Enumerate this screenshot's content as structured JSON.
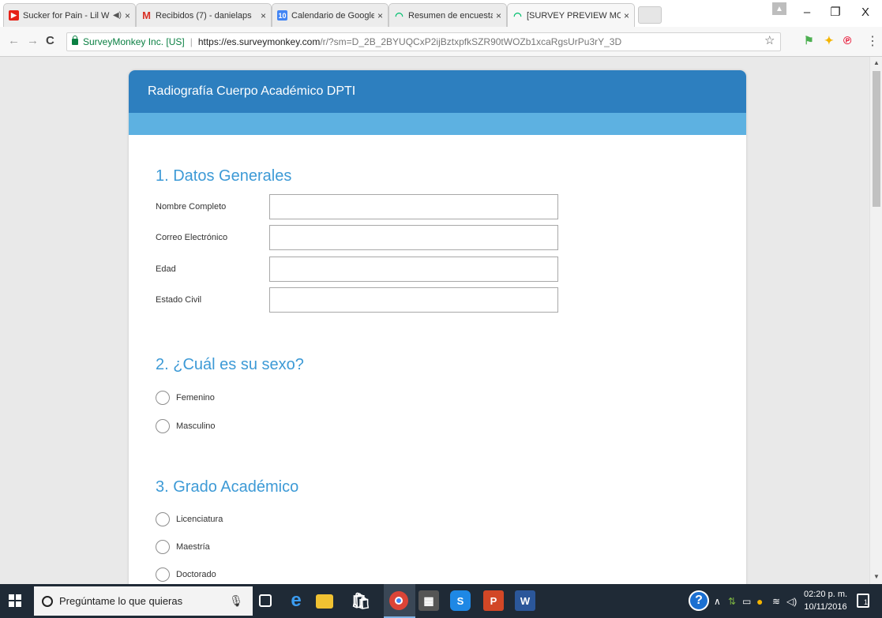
{
  "browser": {
    "tabs": [
      {
        "label": "Sucker for Pain - Lil W",
        "favicon": "youtube-icon",
        "color": "#e62117",
        "glyph": "▶",
        "audio": true
      },
      {
        "label": "Recibidos (7) - danielaps",
        "favicon": "gmail-icon",
        "color": "#d93025",
        "glyph": "M"
      },
      {
        "label": "Calendario de Google - I",
        "favicon": "calendar-icon",
        "color": "#4285f4",
        "glyph": "10"
      },
      {
        "label": "Resumen de encuestas d",
        "favicon": "surveymonkey-icon",
        "color": "#00bf6f",
        "glyph": "◠"
      },
      {
        "label": "[SURVEY PREVIEW MODE",
        "favicon": "surveymonkey-icon",
        "color": "#00bf6f",
        "glyph": "◠"
      }
    ],
    "tab_close": "×",
    "window_controls": {
      "minimize": "–",
      "maximize": "❐",
      "close": "X"
    },
    "address": {
      "secure_label": "SurveyMonkey Inc. [US]",
      "separator": "|",
      "url_scheme_host": "https://es.surveymonkey.com",
      "url_path": "/r/?sm=D_2B_2BYUQCxP2ijBztxpfkSZR90tWOZb1xcaRgsUrPu3rY_3D"
    }
  },
  "survey": {
    "title": "Radiografía Cuerpo Académico DPTI",
    "questions": [
      {
        "title": "1. Datos Generales",
        "fields": [
          "Nombre Completo",
          "Correo Electrónico",
          "Edad",
          "Estado Civil"
        ]
      },
      {
        "title": "2. ¿Cuál es su sexo?",
        "options": [
          "Femenino",
          "Masculino"
        ]
      },
      {
        "title": "3. Grado Académico",
        "options": [
          "Licenciatura",
          "Maestría",
          "Doctorado"
        ]
      }
    ],
    "colors": {
      "header": "#2d7fbf",
      "subbar": "#5db1e1",
      "question_title": "#3d9ad6"
    }
  },
  "taskbar": {
    "search_placeholder": "Pregúntame lo que quieras",
    "clock_time": "02:20 p. m.",
    "clock_date": "10/11/2016",
    "notification_count": "1"
  }
}
